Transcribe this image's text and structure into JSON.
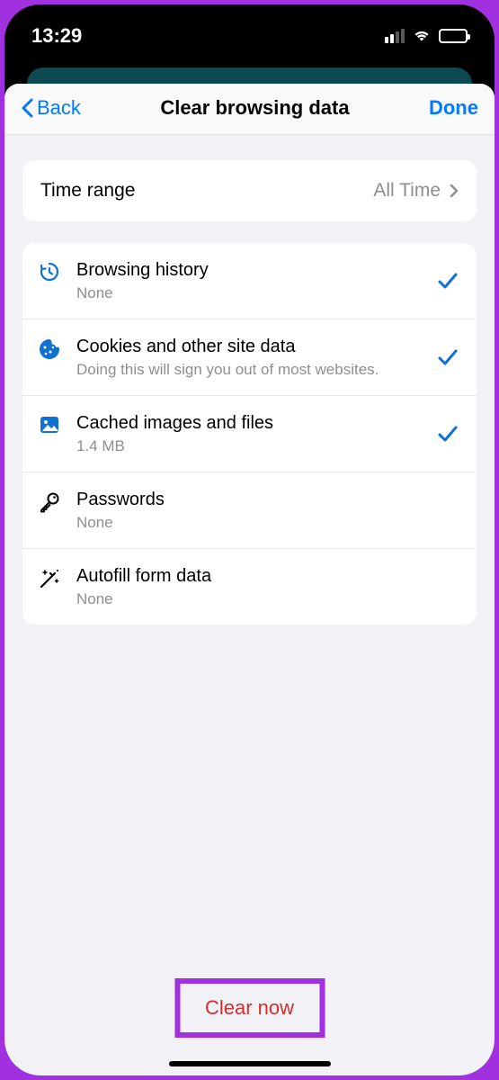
{
  "status": {
    "time": "13:29"
  },
  "nav": {
    "back": "Back",
    "title": "Clear browsing data",
    "done": "Done"
  },
  "time_range": {
    "label": "Time range",
    "value": "All Time"
  },
  "items": [
    {
      "title": "Browsing history",
      "subtitle": "None",
      "icon": "history",
      "checked": true
    },
    {
      "title": "Cookies and other site data",
      "subtitle": "Doing this will sign you out of most websites.",
      "icon": "cookie",
      "checked": true
    },
    {
      "title": "Cached images and files",
      "subtitle": "1.4 MB",
      "icon": "image",
      "checked": true
    },
    {
      "title": "Passwords",
      "subtitle": "None",
      "icon": "key",
      "checked": false
    },
    {
      "title": "Autofill form data",
      "subtitle": "None",
      "icon": "wand",
      "checked": false
    }
  ],
  "clear_button": "Clear now"
}
